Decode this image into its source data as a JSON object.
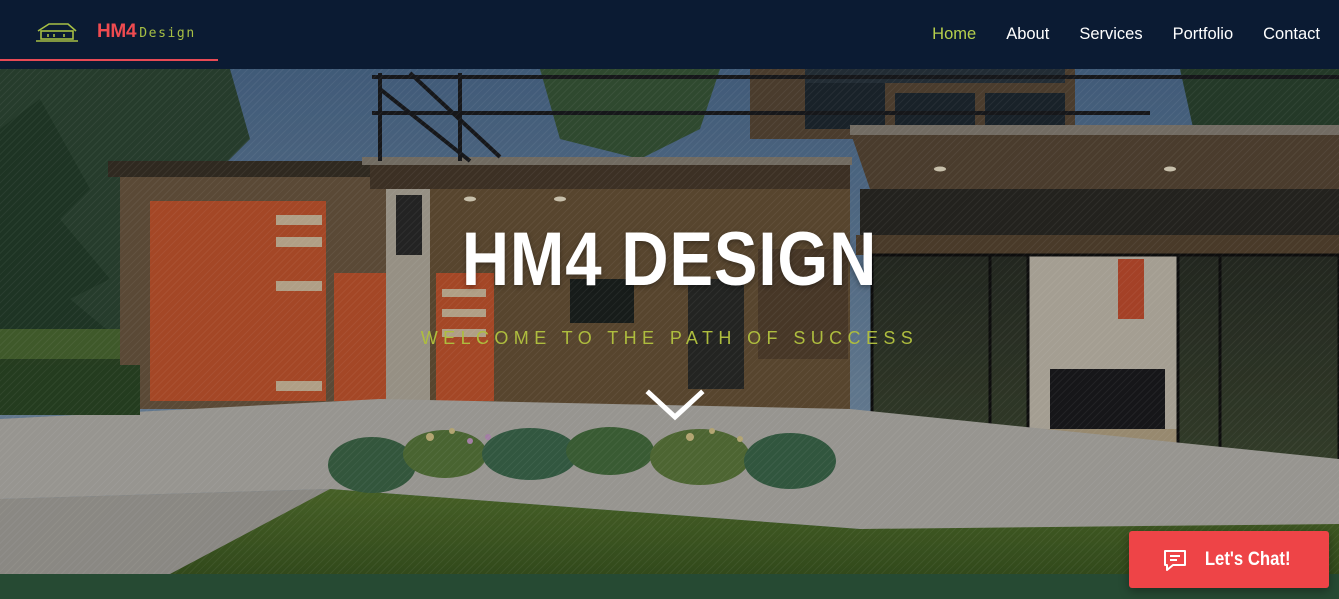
{
  "brand": {
    "name_strong": "HM4",
    "name_light": "Design",
    "logo_icon": "house-outline-icon"
  },
  "nav": {
    "items": [
      {
        "label": "Home",
        "active": true
      },
      {
        "label": "About",
        "active": false
      },
      {
        "label": "Services",
        "active": false
      },
      {
        "label": "Portfolio",
        "active": false
      },
      {
        "label": "Contact",
        "active": false
      }
    ]
  },
  "hero": {
    "title": "HM4 DESIGN",
    "subtitle": "WELCOME TO THE PATH OF SUCCESS",
    "scroll_icon": "chevron-down-icon"
  },
  "chat": {
    "label": "Let's Chat!",
    "icon": "chat-bubble-icon"
  },
  "colors": {
    "header_bg": "#0b1b33",
    "accent_red": "#ef4b50",
    "accent_green": "#b6cf4c",
    "band_green": "#264a33",
    "chat_red": "#ee4447"
  }
}
